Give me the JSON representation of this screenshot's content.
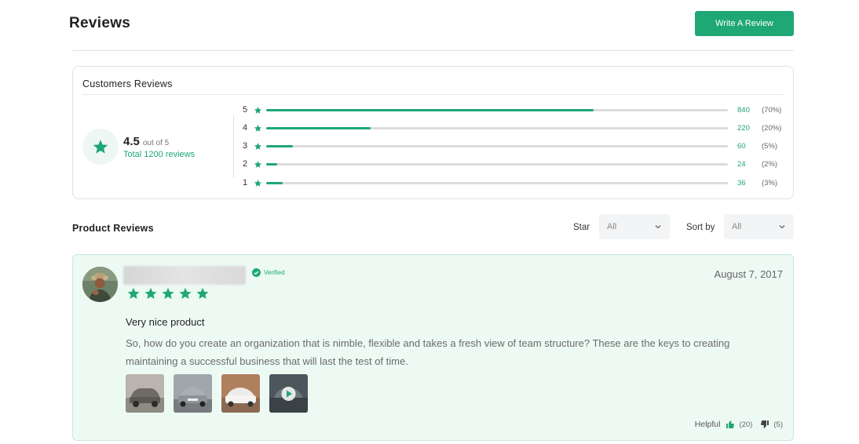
{
  "header": {
    "title": "Reviews",
    "write_review_label": "Write A Review"
  },
  "summary": {
    "title": "Customers Reviews",
    "average": "4.5",
    "out_of": "out of 5",
    "total_label": "Total 1200 reviews",
    "accent_color": "#1fa776",
    "distribution": [
      {
        "star": "5",
        "count": "840",
        "percent_label": "(70%)",
        "fill_fraction": 0.71
      },
      {
        "star": "4",
        "count": "220",
        "percent_label": "(20%)",
        "fill_fraction": 0.227
      },
      {
        "star": "3",
        "count": "60",
        "percent_label": "(5%)",
        "fill_fraction": 0.057
      },
      {
        "star": "2",
        "count": "24",
        "percent_label": "(2%)",
        "fill_fraction": 0.024
      },
      {
        "star": "1",
        "count": "36",
        "percent_label": "(3%)",
        "fill_fraction": 0.035
      }
    ]
  },
  "product_reviews": {
    "title": "Product Reviews",
    "star_filter_label": "Star",
    "star_filter_value": "All",
    "sort_label": "Sort by",
    "sort_value": "All"
  },
  "review": {
    "verified_label": "Verified",
    "rating": 5,
    "date": "August 7, 2017",
    "heading": "Very nice product",
    "body": "So, how do you create an organization that is nimble, flexible and takes a fresh view of team structure? These are the keys to creating maintaining a successful business that will last the test of time.",
    "media": [
      {
        "type": "image",
        "icon": "car-photo"
      },
      {
        "type": "image",
        "icon": "car-photo"
      },
      {
        "type": "image",
        "icon": "car-photo"
      },
      {
        "type": "video",
        "icon": "play-icon"
      }
    ],
    "helpful_label": "Helpful",
    "helpful_up": "(20)",
    "helpful_down": "(5)"
  }
}
